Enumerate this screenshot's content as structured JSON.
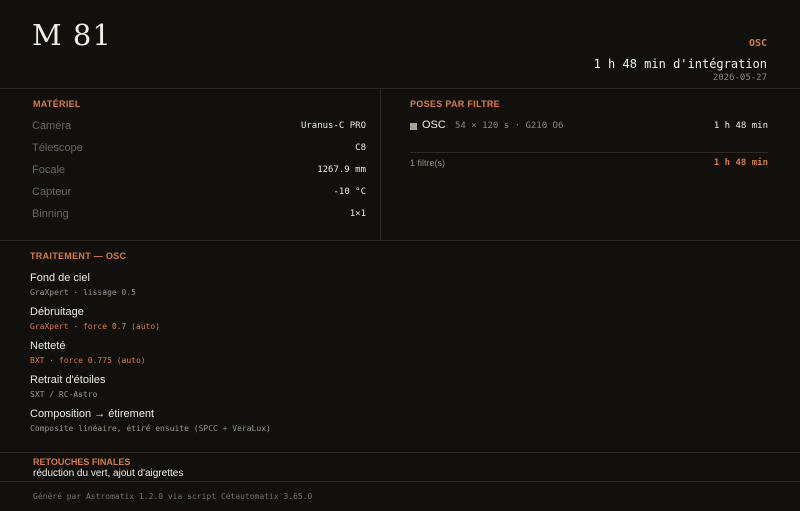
{
  "header": {
    "title": "M 81",
    "filter": "OSC",
    "total_integration": "1 h 48 min d'intégration",
    "date": "2026-05-27"
  },
  "materiel": {
    "label": "MATÉRIEL",
    "rows": [
      {
        "key": "Caméra",
        "value": "Uranus-C PRO"
      },
      {
        "key": "Télescope",
        "value": "C8"
      },
      {
        "key": "Focale",
        "value": "1267.9 mm"
      },
      {
        "key": "Capteur",
        "value": "-10 °C"
      },
      {
        "key": "Binning",
        "value": "1×1"
      }
    ]
  },
  "poses": {
    "label": "POSES PAR FILTRE",
    "items": [
      {
        "name": "OSC",
        "detail": "54 × 120 s · G210 O6",
        "duration": "1 h 48 min"
      }
    ],
    "count": "1 filtre(s)",
    "total": "1 h 48 min"
  },
  "traitement": {
    "label": "TRAITEMENT — OSC",
    "steps": [
      {
        "title": "Fond de ciel",
        "detail": "GraXpert · lissage 0.5",
        "accent": false
      },
      {
        "title": "Débruitage",
        "detail": "GraXpert · force 0.7 (auto)",
        "accent": true
      },
      {
        "title": "Netteté",
        "detail": "BXT · force 0.775 (auto)",
        "accent": true
      },
      {
        "title": "Retrait d'étoiles",
        "detail": "SXT / RC-Astro",
        "accent": false
      },
      {
        "title": "Composition → étirement",
        "detail": "Composite linéaire, étiré ensuite (SPCC + VeraLux)",
        "accent": false
      }
    ]
  },
  "retouches": {
    "label": "RETOUCHES FINALES",
    "text": "réduction du vert, ajout d'aigrettes"
  },
  "footer": {
    "text": "Généré par Astromatix 1.2.0 via script Cétautomatix 3.65.0"
  },
  "colors": {
    "background": "#12100d",
    "accent": "#d97c3e",
    "muted": "#6c665d",
    "divider": "#2e2a25"
  }
}
